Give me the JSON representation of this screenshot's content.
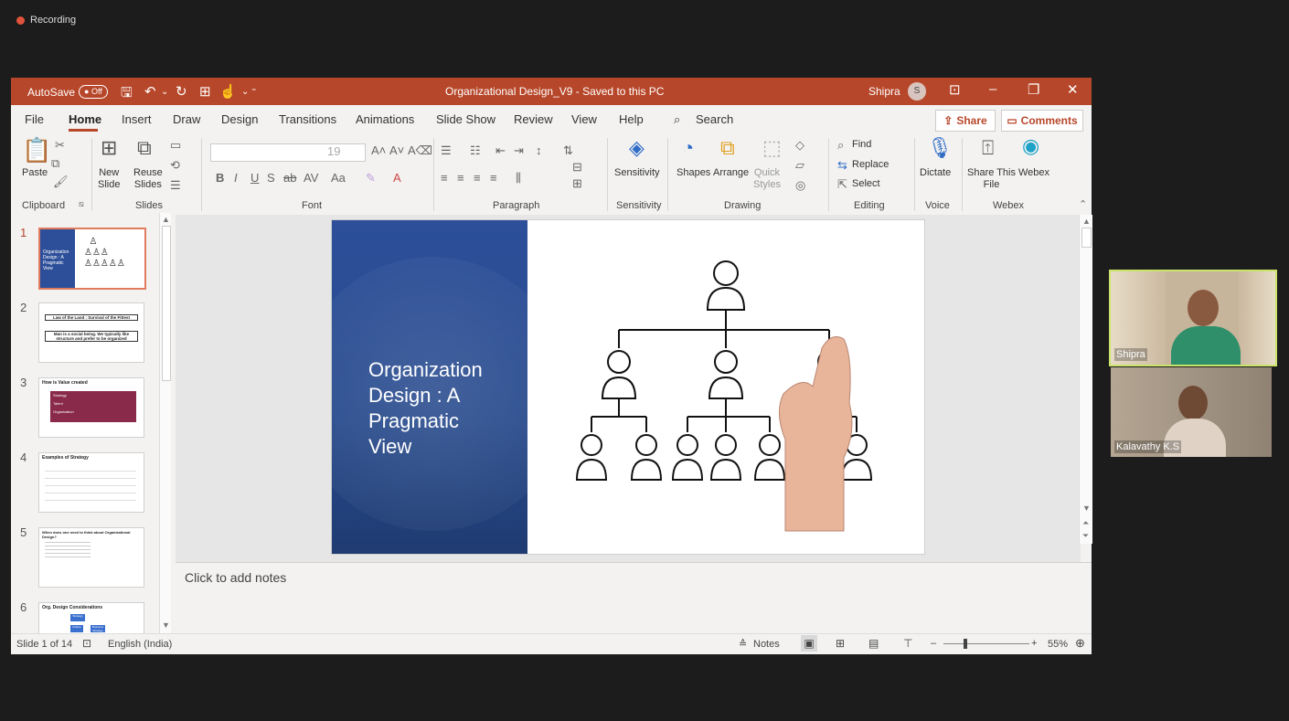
{
  "recording": {
    "label": "Recording"
  },
  "titlebar": {
    "autosave_label": "AutoSave",
    "autosave_state": "Off",
    "doc_title": "Organizational Design_V9  -  Saved to this PC",
    "user_name": "Shipra",
    "user_initial": "S"
  },
  "menu": {
    "items": [
      "File",
      "Home",
      "Insert",
      "Draw",
      "Design",
      "Transitions",
      "Animations",
      "Slide Show",
      "Review",
      "View",
      "Help"
    ],
    "search": "Search",
    "share": "Share",
    "comments": "Comments"
  },
  "ribbon": {
    "paste": "Paste",
    "new_slide": "New\nSlide",
    "reuse_slides": "Reuse\nSlides",
    "font_size": "19",
    "sensitivity": "Sensitivity",
    "shapes": "Shapes",
    "arrange": "Arrange",
    "quick_styles": "Quick\nStyles",
    "find": "Find",
    "replace": "Replace",
    "select": "Select",
    "dictate": "Dictate",
    "share_this_file": "Share This\nFile",
    "webex": "Webex",
    "groups": {
      "clipboard": "Clipboard",
      "slides": "Slides",
      "font": "Font",
      "paragraph": "Paragraph",
      "sensitivity": "Sensitivity",
      "drawing": "Drawing",
      "editing": "Editing",
      "voice": "Voice",
      "webex": "Webex"
    }
  },
  "thumbnails": [
    {
      "num": "1",
      "text": "Organization Design : A Pragmatic View"
    },
    {
      "num": "2",
      "line1": "Law of the Land : Survival of the Fittest",
      "line2": "Man is a social being. We typically like structure and prefer to be organized"
    },
    {
      "num": "3",
      "title": "How is Value created",
      "items": [
        "Strategy",
        "Talent",
        "Organization"
      ]
    },
    {
      "num": "4",
      "title": "Examples of Strategy"
    },
    {
      "num": "5",
      "title": "When does one need to think about Organizational Design?"
    },
    {
      "num": "6",
      "title": "Org. Design Considerations",
      "boxes": [
        "Strategy",
        "Culture",
        "Business Strategy"
      ]
    }
  ],
  "slide": {
    "title": "Organization\nDesign : A\nPragmatic\nView"
  },
  "notes": {
    "placeholder": "Click to add notes"
  },
  "status": {
    "slide_info": "Slide 1 of 14",
    "language": "English (India)",
    "notes_btn": "Notes",
    "zoom": "55%"
  },
  "video": {
    "participant1": "Shipra",
    "participant2": "Kalavathy K.S"
  },
  "colors": {
    "accent": "#b7472a",
    "slide_blue": "#2d4f9a"
  }
}
